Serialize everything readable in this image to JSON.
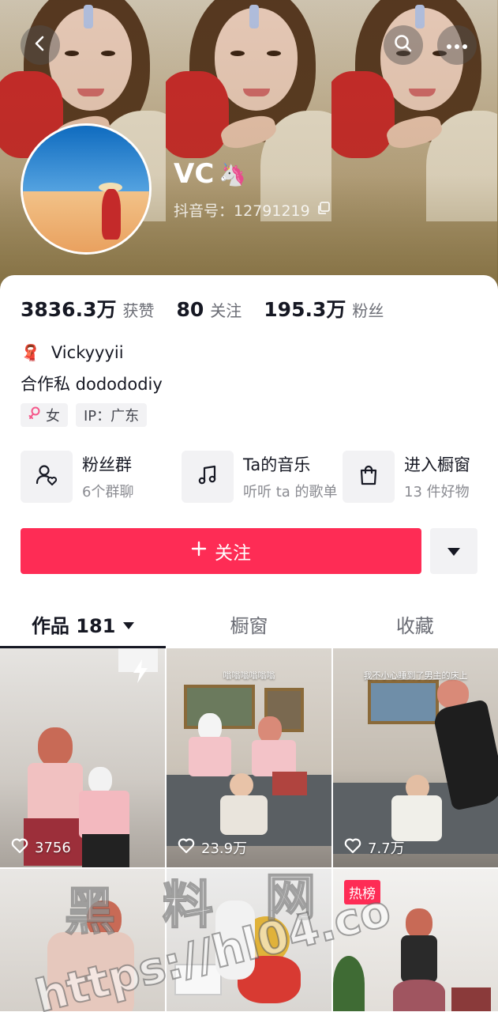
{
  "profile": {
    "name": "VC",
    "name_emoji": "🦄",
    "douyin_id_label": "抖音号：12791219"
  },
  "stats": [
    {
      "value": "3836.3万",
      "label": "获赞"
    },
    {
      "value": "80",
      "label": "关注"
    },
    {
      "value": "195.3万",
      "label": "粉丝"
    }
  ],
  "bio": {
    "line1_emoji": "🧣",
    "line1": "Vickyyyii",
    "line2": "合作私 dodododiy"
  },
  "tags": {
    "gender": "女",
    "ip": "IP：广东"
  },
  "features": [
    {
      "icon": "fan-group-icon",
      "title": "粉丝群",
      "subtitle": "6个群聊"
    },
    {
      "icon": "music-note-icon",
      "title": "Ta的音乐",
      "subtitle": "听听 ta 的歌单"
    },
    {
      "icon": "shopping-bag-icon",
      "title": "进入橱窗",
      "subtitle": "13 件好物"
    }
  ],
  "actions": {
    "follow_label": "关注"
  },
  "tabs": [
    {
      "label": "作品 181",
      "active": true
    },
    {
      "label": "橱窗",
      "active": false
    },
    {
      "label": "收藏",
      "active": false
    }
  ],
  "videos": [
    {
      "likes": "3756",
      "caption": "",
      "badge": ""
    },
    {
      "likes": "23.9万",
      "caption": "嗡嗡嗡嗡嗡嗡",
      "badge": ""
    },
    {
      "likes": "7.7万",
      "caption": "我不小心睡到了男主的床上",
      "badge": ""
    },
    {
      "likes": "",
      "caption": "",
      "badge": ""
    },
    {
      "likes": "",
      "caption": "",
      "badge": ""
    },
    {
      "likes": "",
      "caption": "",
      "badge": "热榜"
    }
  ],
  "watermark": {
    "chars": [
      "黑",
      "料",
      "网"
    ],
    "url": "https://hl04.co"
  },
  "colors": {
    "accent": "#fe2c55",
    "text": "#161823",
    "muted": "#6b6d75"
  }
}
